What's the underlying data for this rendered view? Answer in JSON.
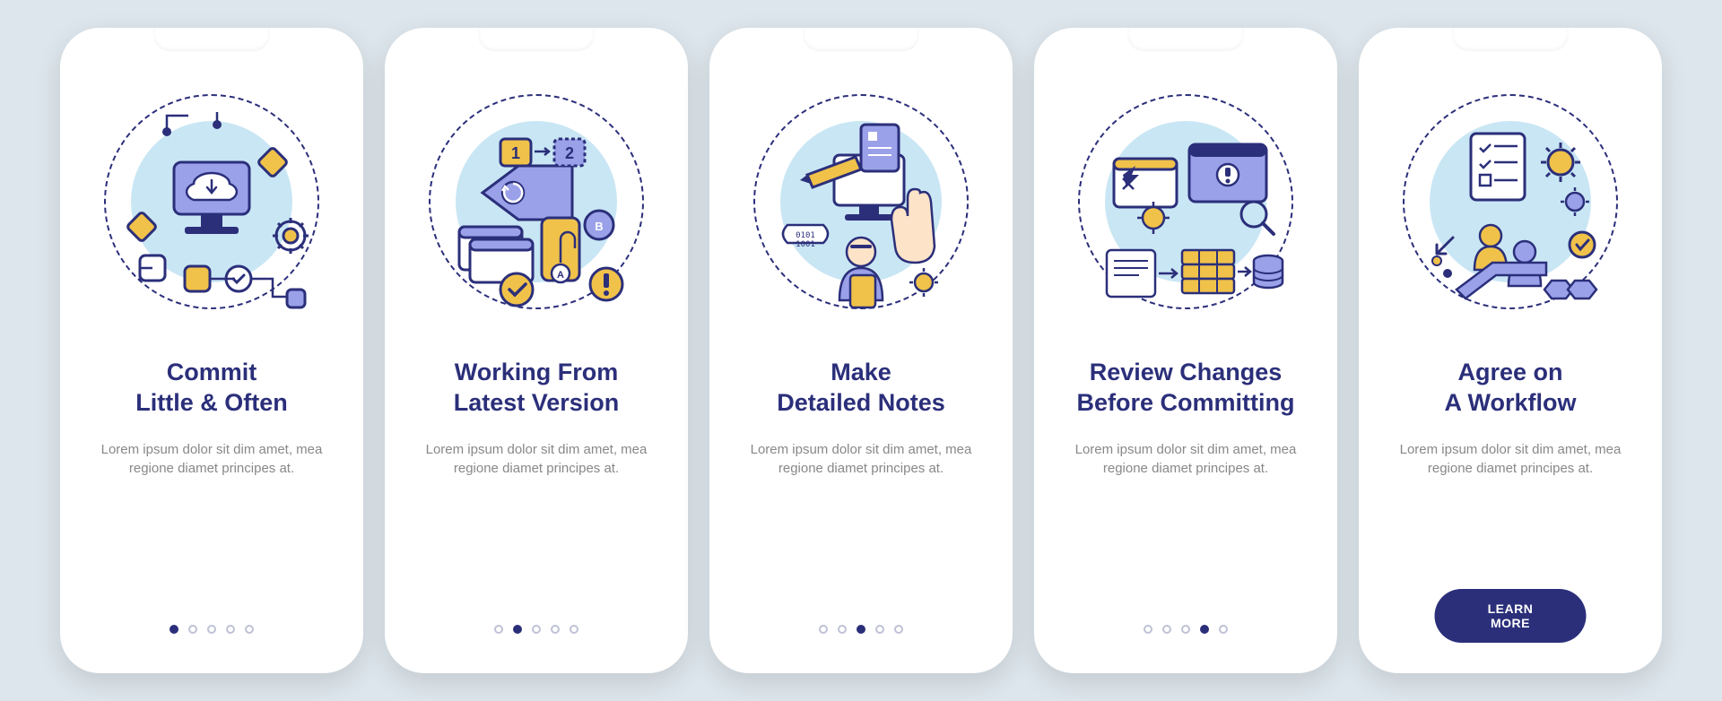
{
  "cards": [
    {
      "icon": "commit-often-icon",
      "title": "Commit\nLittle & Often",
      "description": "Lorem ipsum dolor sit dim amet, mea regione diamet principes at.",
      "activeDot": 0,
      "showCta": false
    },
    {
      "icon": "latest-version-icon",
      "title": "Working From\nLatest Version",
      "description": "Lorem ipsum dolor sit dim amet, mea regione diamet principes at.",
      "activeDot": 1,
      "showCta": false
    },
    {
      "icon": "detailed-notes-icon",
      "title": "Make\nDetailed Notes",
      "description": "Lorem ipsum dolor sit dim amet, mea regione diamet principes at.",
      "activeDot": 2,
      "showCta": false
    },
    {
      "icon": "review-changes-icon",
      "title": "Review Changes\nBefore Committing",
      "description": "Lorem ipsum dolor sit dim amet, mea regione diamet principes at.",
      "activeDot": 3,
      "showCta": false
    },
    {
      "icon": "workflow-icon",
      "title": "Agree on\nA Workflow",
      "description": "Lorem ipsum dolor sit dim amet, mea regione diamet principes at.",
      "activeDot": 4,
      "showCta": true
    }
  ],
  "ctaLabel": "LEARN MORE",
  "dotCount": 5,
  "colors": {
    "navy": "#2b2f7a",
    "periwinkle": "#9aa1e8",
    "amber": "#f0c24a",
    "sky": "#c9e6f4",
    "pageBg": "#dde6ec"
  }
}
